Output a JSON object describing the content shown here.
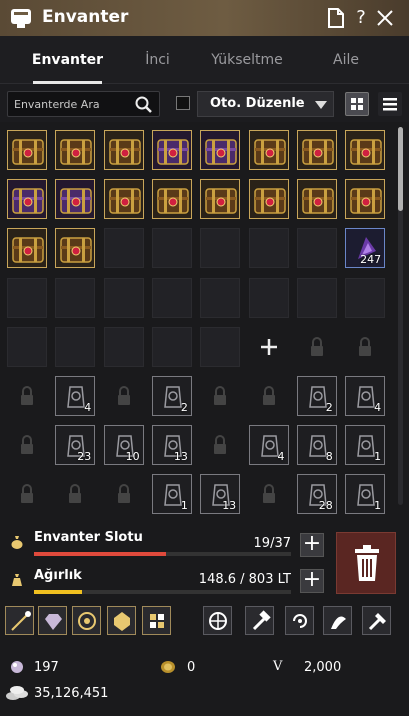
{
  "window": {
    "title": "Envanter"
  },
  "tabs": [
    {
      "label": "Envanter",
      "active": true
    },
    {
      "label": "İnci",
      "active": false
    },
    {
      "label": "Yükseltme",
      "active": false
    },
    {
      "label": "Aile",
      "active": false
    }
  ],
  "toolbar": {
    "search_placeholder": "Envanterde Ara",
    "sort_label": "Oto. Düzenle"
  },
  "inventory": {
    "slots": [
      {
        "type": "gold"
      },
      {
        "type": "gold"
      },
      {
        "type": "gold"
      },
      {
        "type": "purple"
      },
      {
        "type": "purple"
      },
      {
        "type": "gold"
      },
      {
        "type": "gold"
      },
      {
        "type": "gold"
      },
      {
        "type": "purple"
      },
      {
        "type": "purple"
      },
      {
        "type": "gold"
      },
      {
        "type": "gold"
      },
      {
        "type": "gold"
      },
      {
        "type": "gold"
      },
      {
        "type": "gold"
      },
      {
        "type": "gold"
      },
      {
        "type": "gold"
      },
      {
        "type": "gold"
      },
      {
        "type": "empty"
      },
      {
        "type": "empty"
      },
      {
        "type": "empty"
      },
      {
        "type": "empty"
      },
      {
        "type": "empty"
      },
      {
        "type": "blue",
        "count": "247"
      },
      {
        "type": "empty"
      },
      {
        "type": "empty"
      },
      {
        "type": "empty"
      },
      {
        "type": "empty"
      },
      {
        "type": "empty"
      },
      {
        "type": "empty"
      },
      {
        "type": "empty"
      },
      {
        "type": "empty"
      },
      {
        "type": "empty"
      },
      {
        "type": "empty"
      },
      {
        "type": "empty"
      },
      {
        "type": "empty"
      },
      {
        "type": "empty"
      },
      {
        "type": "add"
      },
      {
        "type": "locked"
      },
      {
        "type": "locked"
      },
      {
        "type": "locked"
      },
      {
        "type": "sil",
        "count": "4"
      },
      {
        "type": "locked"
      },
      {
        "type": "sil",
        "count": "2"
      },
      {
        "type": "locked"
      },
      {
        "type": "locked"
      },
      {
        "type": "sil",
        "count": "2"
      },
      {
        "type": "sil",
        "count": "4"
      },
      {
        "type": "locked"
      },
      {
        "type": "sil",
        "count": "23"
      },
      {
        "type": "sil",
        "count": "10"
      },
      {
        "type": "sil",
        "count": "13"
      },
      {
        "type": "locked"
      },
      {
        "type": "sil",
        "count": "4"
      },
      {
        "type": "sil",
        "count": "8"
      },
      {
        "type": "sil",
        "count": "1"
      },
      {
        "type": "locked"
      },
      {
        "type": "locked"
      },
      {
        "type": "locked"
      },
      {
        "type": "sil",
        "count": "1"
      },
      {
        "type": "sil",
        "count": "13"
      },
      {
        "type": "locked"
      },
      {
        "type": "sil",
        "count": "28"
      },
      {
        "type": "sil",
        "count": "1"
      }
    ]
  },
  "stats": {
    "slots": {
      "label": "Envanter Slotu",
      "value": "19/37",
      "fraction": 0.5135
    },
    "weight": {
      "label": "Ağırlık",
      "value": "148.6 / 803 LT",
      "fraction": 0.185
    }
  },
  "actions": [
    {
      "name": "enhance-icon"
    },
    {
      "name": "gem-icon"
    },
    {
      "name": "alchemy-icon"
    },
    {
      "name": "crystal-icon"
    },
    {
      "name": "grid-icon"
    },
    {
      "name": "globe-icon"
    },
    {
      "name": "hammer-icon"
    },
    {
      "name": "swirl-icon"
    },
    {
      "name": "dragon-icon"
    },
    {
      "name": "repair-icon"
    }
  ],
  "currency": {
    "pearls": "197",
    "medals": "0",
    "v_label": "V",
    "v_value": "2,000",
    "silver": "35,126,451"
  },
  "colors": {
    "accent_red": "#e04a3c",
    "weight_yellow": "#f0c020",
    "titlebar": "#5a4a35"
  }
}
